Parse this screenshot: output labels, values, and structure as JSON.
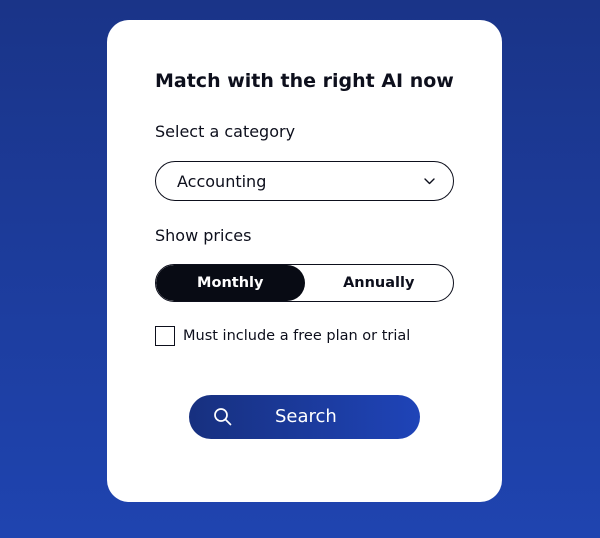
{
  "card": {
    "title": "Match with the right AI now"
  },
  "category": {
    "label": "Select a category",
    "selected": "Accounting",
    "icon": "chevron-down-icon"
  },
  "prices": {
    "label": "Show prices",
    "options": [
      {
        "label": "Monthly",
        "active": true
      },
      {
        "label": "Annually",
        "active": false
      }
    ]
  },
  "filter": {
    "label": "Must include a free plan or trial",
    "checked": false
  },
  "search": {
    "label": "Search",
    "icon": "search-icon"
  },
  "colors": {
    "background_top": "#1a3488",
    "background_bottom": "#1f44b0",
    "card": "#ffffff",
    "text": "#0d0f1c",
    "toggle_active": "#080b14",
    "button_start": "#17307f",
    "button_end": "#1f44b8"
  }
}
